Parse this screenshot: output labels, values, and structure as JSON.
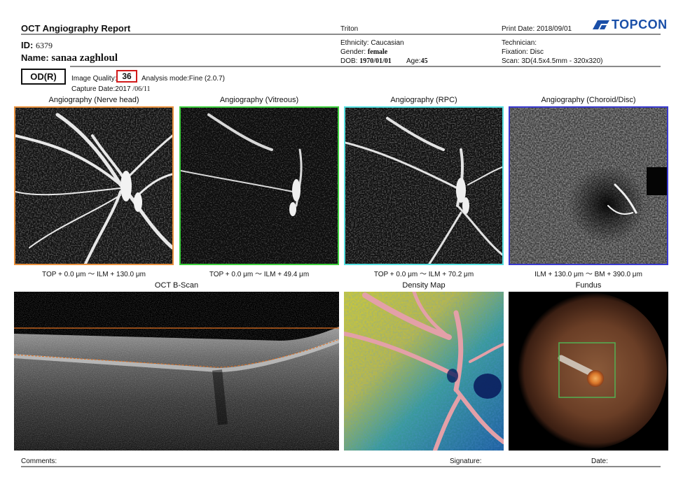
{
  "header": {
    "title": "OCT Angiography Report",
    "device": "Triton",
    "print_date": "Print Date: 2018/09/01",
    "brand": "TOPCON"
  },
  "patient": {
    "id_label": "ID:",
    "id_value": "6379",
    "name_label": "Name:",
    "name_value": "sanaa zaghloul",
    "ethnicity": "Ethnicity: Caucasian",
    "gender_label": "Gender:",
    "gender_value": "female",
    "dob_label": "DOB:",
    "dob_value": "1970/01/01",
    "age_label": "Age:",
    "age_value": "45",
    "technician": "Technician:",
    "fixation": "Fixation: Disc",
    "scan": "Scan: 3D(4.5x4.5mm - 320x320)"
  },
  "exam": {
    "eye": "OD(R)",
    "quality_label": "Image Quality:",
    "quality_value": "36",
    "analysis_mode": "Analysis mode:Fine (2.0.7)",
    "capture_label": "Capture Date:",
    "capture_year": "2017",
    "capture_rest": "/06/11"
  },
  "panels": {
    "nerve_head": {
      "title": "Angiography (Nerve head)",
      "caption": "TOP + 0.0 μm ～ ILM + 130.0 μm",
      "border": "#e8913e"
    },
    "vitreous": {
      "title": "Angiography (Vitreous)",
      "caption": "TOP + 0.0 μm ～ ILM + 49.4 μm",
      "border": "#3fcf3f"
    },
    "rpc": {
      "title": "Angiography (RPC)",
      "caption": "TOP + 0.0 μm ～ ILM + 70.2 μm",
      "border": "#56e0e0"
    },
    "choroid": {
      "title": "Angiography (Choroid/Disc)",
      "caption": "ILM + 130.0 μm ～ BM + 390.0 μm",
      "border": "#3a3acf"
    },
    "bscan": {
      "title": "OCT B-Scan"
    },
    "density": {
      "title": "Density Map"
    },
    "fundus": {
      "title": "Fundus"
    }
  },
  "footer": {
    "comments": "Comments:",
    "signature": "Signature:",
    "date": "Date:"
  },
  "colors": {
    "quality_box": "#d11a1a",
    "brand_blue": "#1a4fa8",
    "rule": "#8a8a8a"
  }
}
